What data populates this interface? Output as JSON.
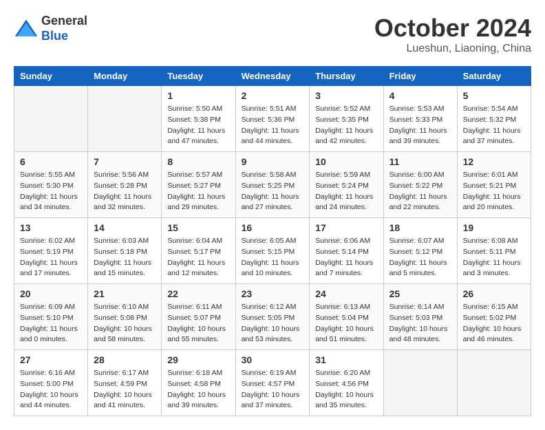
{
  "header": {
    "logo_line1": "General",
    "logo_line2": "Blue",
    "month_title": "October 2024",
    "location": "Lueshun, Liaoning, China"
  },
  "weekdays": [
    "Sunday",
    "Monday",
    "Tuesday",
    "Wednesday",
    "Thursday",
    "Friday",
    "Saturday"
  ],
  "weeks": [
    [
      {
        "day": "",
        "empty": true
      },
      {
        "day": "",
        "empty": true
      },
      {
        "day": "1",
        "sunrise": "5:50 AM",
        "sunset": "5:38 PM",
        "daylight": "11 hours and 47 minutes."
      },
      {
        "day": "2",
        "sunrise": "5:51 AM",
        "sunset": "5:36 PM",
        "daylight": "11 hours and 44 minutes."
      },
      {
        "day": "3",
        "sunrise": "5:52 AM",
        "sunset": "5:35 PM",
        "daylight": "11 hours and 42 minutes."
      },
      {
        "day": "4",
        "sunrise": "5:53 AM",
        "sunset": "5:33 PM",
        "daylight": "11 hours and 39 minutes."
      },
      {
        "day": "5",
        "sunrise": "5:54 AM",
        "sunset": "5:32 PM",
        "daylight": "11 hours and 37 minutes."
      }
    ],
    [
      {
        "day": "6",
        "sunrise": "5:55 AM",
        "sunset": "5:30 PM",
        "daylight": "11 hours and 34 minutes."
      },
      {
        "day": "7",
        "sunrise": "5:56 AM",
        "sunset": "5:28 PM",
        "daylight": "11 hours and 32 minutes."
      },
      {
        "day": "8",
        "sunrise": "5:57 AM",
        "sunset": "5:27 PM",
        "daylight": "11 hours and 29 minutes."
      },
      {
        "day": "9",
        "sunrise": "5:58 AM",
        "sunset": "5:25 PM",
        "daylight": "11 hours and 27 minutes."
      },
      {
        "day": "10",
        "sunrise": "5:59 AM",
        "sunset": "5:24 PM",
        "daylight": "11 hours and 24 minutes."
      },
      {
        "day": "11",
        "sunrise": "6:00 AM",
        "sunset": "5:22 PM",
        "daylight": "11 hours and 22 minutes."
      },
      {
        "day": "12",
        "sunrise": "6:01 AM",
        "sunset": "5:21 PM",
        "daylight": "11 hours and 20 minutes."
      }
    ],
    [
      {
        "day": "13",
        "sunrise": "6:02 AM",
        "sunset": "5:19 PM",
        "daylight": "11 hours and 17 minutes."
      },
      {
        "day": "14",
        "sunrise": "6:03 AM",
        "sunset": "5:18 PM",
        "daylight": "11 hours and 15 minutes."
      },
      {
        "day": "15",
        "sunrise": "6:04 AM",
        "sunset": "5:17 PM",
        "daylight": "11 hours and 12 minutes."
      },
      {
        "day": "16",
        "sunrise": "6:05 AM",
        "sunset": "5:15 PM",
        "daylight": "11 hours and 10 minutes."
      },
      {
        "day": "17",
        "sunrise": "6:06 AM",
        "sunset": "5:14 PM",
        "daylight": "11 hours and 7 minutes."
      },
      {
        "day": "18",
        "sunrise": "6:07 AM",
        "sunset": "5:12 PM",
        "daylight": "11 hours and 5 minutes."
      },
      {
        "day": "19",
        "sunrise": "6:08 AM",
        "sunset": "5:11 PM",
        "daylight": "11 hours and 3 minutes."
      }
    ],
    [
      {
        "day": "20",
        "sunrise": "6:09 AM",
        "sunset": "5:10 PM",
        "daylight": "11 hours and 0 minutes."
      },
      {
        "day": "21",
        "sunrise": "6:10 AM",
        "sunset": "5:08 PM",
        "daylight": "10 hours and 58 minutes."
      },
      {
        "day": "22",
        "sunrise": "6:11 AM",
        "sunset": "5:07 PM",
        "daylight": "10 hours and 55 minutes."
      },
      {
        "day": "23",
        "sunrise": "6:12 AM",
        "sunset": "5:05 PM",
        "daylight": "10 hours and 53 minutes."
      },
      {
        "day": "24",
        "sunrise": "6:13 AM",
        "sunset": "5:04 PM",
        "daylight": "10 hours and 51 minutes."
      },
      {
        "day": "25",
        "sunrise": "6:14 AM",
        "sunset": "5:03 PM",
        "daylight": "10 hours and 48 minutes."
      },
      {
        "day": "26",
        "sunrise": "6:15 AM",
        "sunset": "5:02 PM",
        "daylight": "10 hours and 46 minutes."
      }
    ],
    [
      {
        "day": "27",
        "sunrise": "6:16 AM",
        "sunset": "5:00 PM",
        "daylight": "10 hours and 44 minutes."
      },
      {
        "day": "28",
        "sunrise": "6:17 AM",
        "sunset": "4:59 PM",
        "daylight": "10 hours and 41 minutes."
      },
      {
        "day": "29",
        "sunrise": "6:18 AM",
        "sunset": "4:58 PM",
        "daylight": "10 hours and 39 minutes."
      },
      {
        "day": "30",
        "sunrise": "6:19 AM",
        "sunset": "4:57 PM",
        "daylight": "10 hours and 37 minutes."
      },
      {
        "day": "31",
        "sunrise": "6:20 AM",
        "sunset": "4:56 PM",
        "daylight": "10 hours and 35 minutes."
      },
      {
        "day": "",
        "empty": true
      },
      {
        "day": "",
        "empty": true
      }
    ]
  ],
  "labels": {
    "sunrise_prefix": "Sunrise: ",
    "sunset_prefix": "Sunset: ",
    "daylight_prefix": "Daylight: "
  }
}
